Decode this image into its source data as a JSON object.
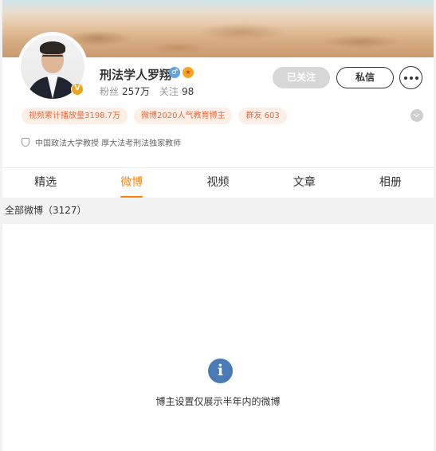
{
  "profile": {
    "name": "刑法学人罗翔",
    "badge_letter": "V",
    "gender_symbol": "♂",
    "medal_symbol": "★",
    "fans_label": "粉丝",
    "fans_count": "257万",
    "follow_label": "关注",
    "follow_count": "98",
    "description": "中国政法大学教授 厚大法考刑法独家教师"
  },
  "actions": {
    "followed_label": "已关注",
    "message_label": "私信"
  },
  "tags": [
    "视频累计播放量3198.7万",
    "微博2020人气教育博主",
    "群友 603"
  ],
  "tabs": [
    {
      "label": "精选"
    },
    {
      "label": "微博"
    },
    {
      "label": "视频"
    },
    {
      "label": "文章"
    },
    {
      "label": "相册"
    }
  ],
  "section": {
    "title": "全部微博（3127）"
  },
  "empty_state": {
    "icon_glyph": "i",
    "message": "博主设置仅展示半年内的微博"
  },
  "colors": {
    "accent": "#ff8200",
    "tag_text": "#e96a3a",
    "tag_bg": "#fdeee6",
    "info_icon": "#4a7ab3"
  }
}
